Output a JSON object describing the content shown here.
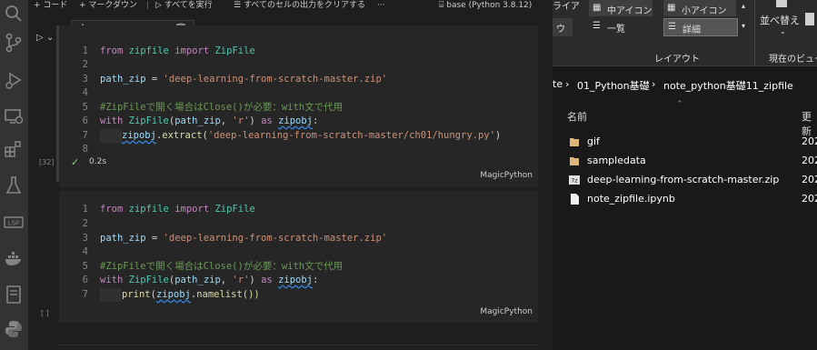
{
  "toolbar": {
    "code_label": "+ コード",
    "markdown_label": "+ マークダウン",
    "run_all_label": "すべてを実行",
    "clear_outputs_label": "すべてのセルの出力をクリアする",
    "more_label": "···",
    "kernel_label": "base (Python 3.8.12)"
  },
  "cells": [
    {
      "exec_count": "[32]",
      "status_icon": "check-icon",
      "duration": "0.2s",
      "language": "MagicPython",
      "line_numbers": [
        "1",
        "2",
        "3",
        "4",
        "5",
        "6",
        "7",
        "8"
      ]
    },
    {
      "exec_count": "[ ]",
      "language": "MagicPython",
      "line_numbers": [
        "1",
        "2",
        "3",
        "4",
        "5",
        "6",
        "7"
      ]
    }
  ],
  "code": {
    "from": "from",
    "import": "import",
    "zipfile_mod": "zipfile",
    "ZipFile": "ZipFile",
    "path_zip": "path_zip",
    "eq": " = ",
    "zip_str": "'deep-learning-from-scratch-master.zip'",
    "comment": "#ZipFileで開く場合はClose()が必要：with文で代用",
    "with": "with",
    "open_paren": "(",
    "comma": ", ",
    "mode_str": "'r'",
    "close_paren": ")",
    "as": "as",
    "zipobj": "zipobj",
    "colon": ":",
    "extract_call": ".extract(",
    "extract_arg": "'deep-learning-from-scratch-master/ch01/hungry.py'",
    "print": "print",
    "namelist_call": ".namelist())"
  },
  "explorer": {
    "ribbon": {
      "medium_icons": "中アイコン",
      "small_icons": "小アイコン",
      "list": "一覧",
      "details": "詳細",
      "sort_by": "並べ替え",
      "layout_group": "レイアウト",
      "current_view_group": "現在のビュー",
      "partial_left_top": "ライア",
      "partial_left_mid": "ウ"
    },
    "breadcrumb": [
      "te",
      "01_Python基礎",
      "note_python基礎11_zipfile"
    ],
    "breadcrumb_sep": "›",
    "columns": {
      "name": "名前",
      "date": "更新"
    },
    "files": [
      {
        "name": "gif",
        "icon": "folder-icon",
        "date": "202"
      },
      {
        "name": "sampledata",
        "icon": "folder-icon",
        "date": "202"
      },
      {
        "name": "deep-learning-from-scratch-master.zip",
        "icon": "zip-archive-icon",
        "date": "202"
      },
      {
        "name": "note_zipfile.ipynb",
        "icon": "file-icon",
        "date": "202"
      }
    ]
  },
  "colors": {
    "accent": "#3794ff",
    "success": "#89d185",
    "folder": "#dcb67a"
  }
}
